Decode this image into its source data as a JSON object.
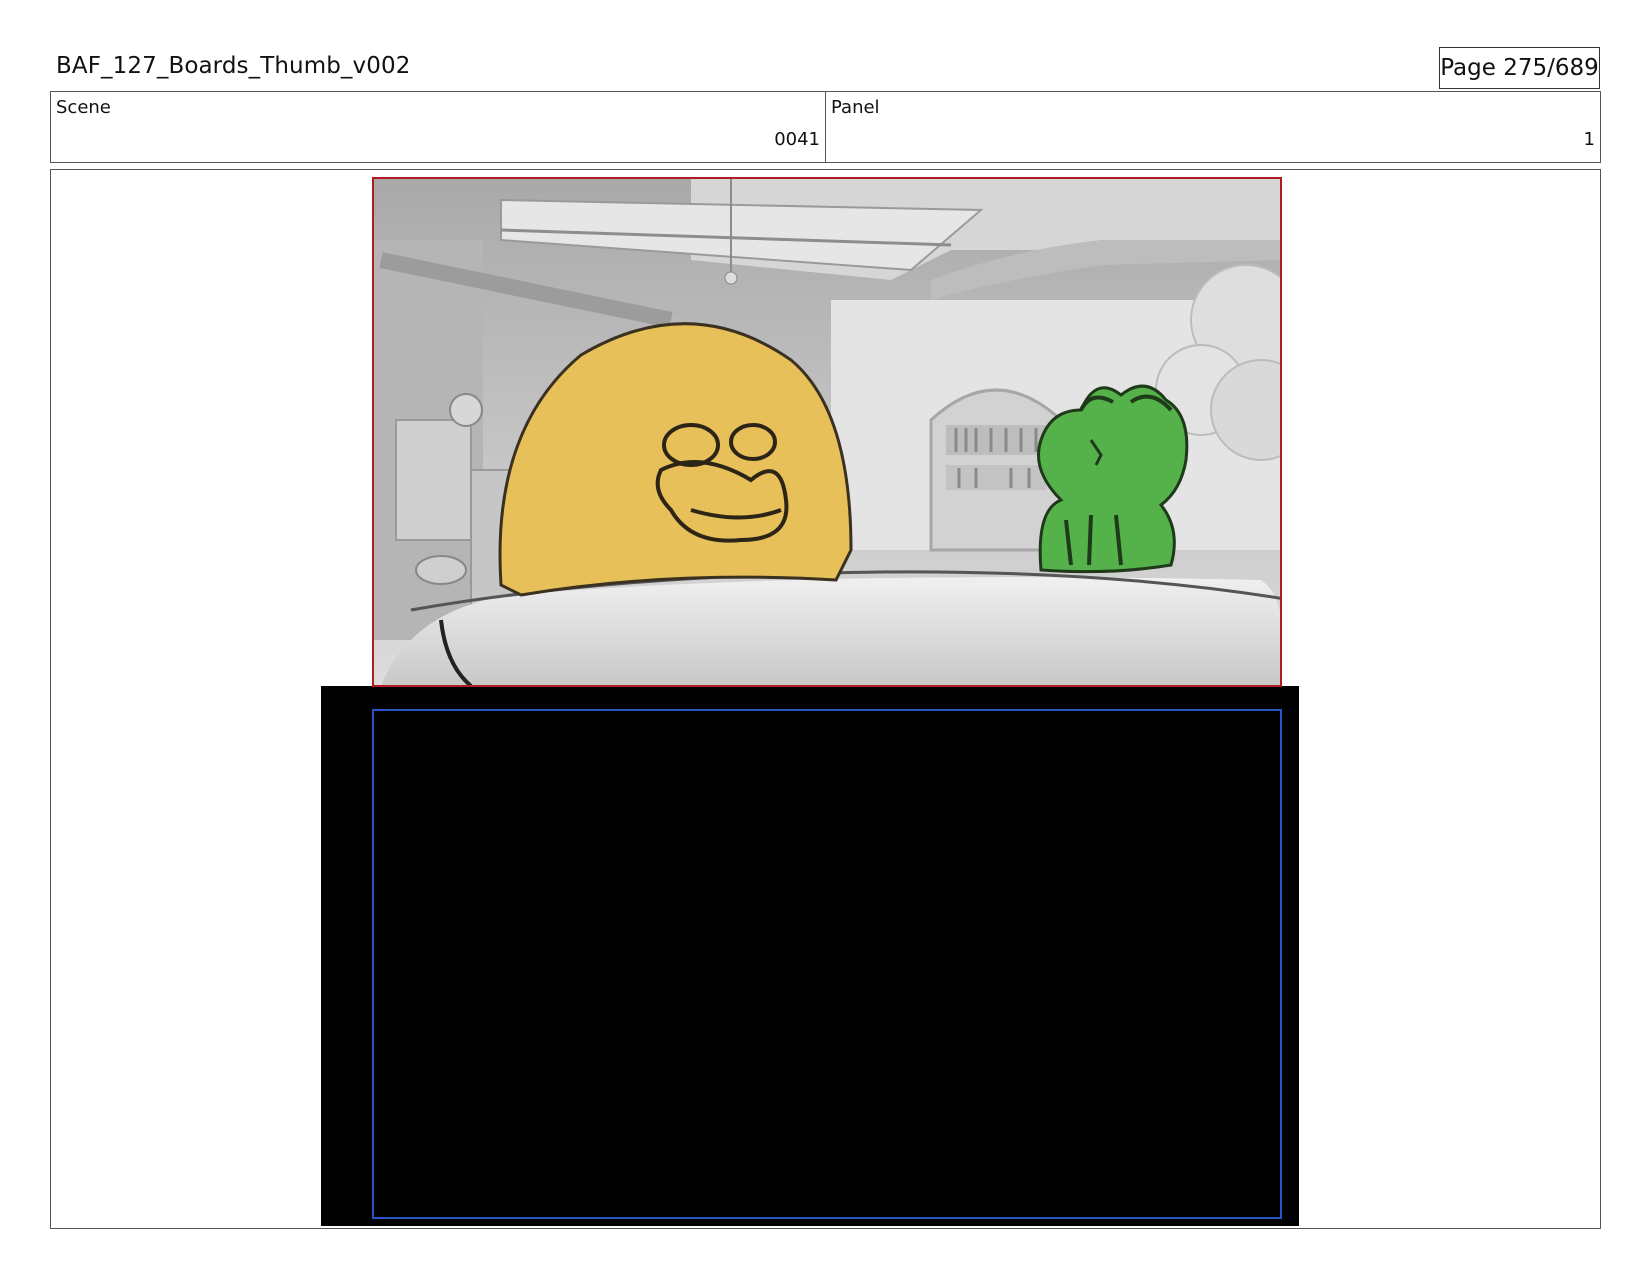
{
  "header": {
    "title": "BAF_127_Boards_Thumb_v002",
    "page": "Page 275/689"
  },
  "info": {
    "scene_label": "Scene",
    "scene_value": "0041",
    "panel_label": "Panel",
    "panel_value": "1"
  },
  "colors": {
    "field_guide_red": "#b01c24",
    "safe_area_blue": "#2a57c8",
    "character_yellow": "#e8c05a",
    "character_green": "#55b24b",
    "background_gray": "#c9c9c9"
  },
  "icons": [
    "yellow-blob-character",
    "green-frog-character",
    "kitchen-background",
    "pot-rim"
  ]
}
